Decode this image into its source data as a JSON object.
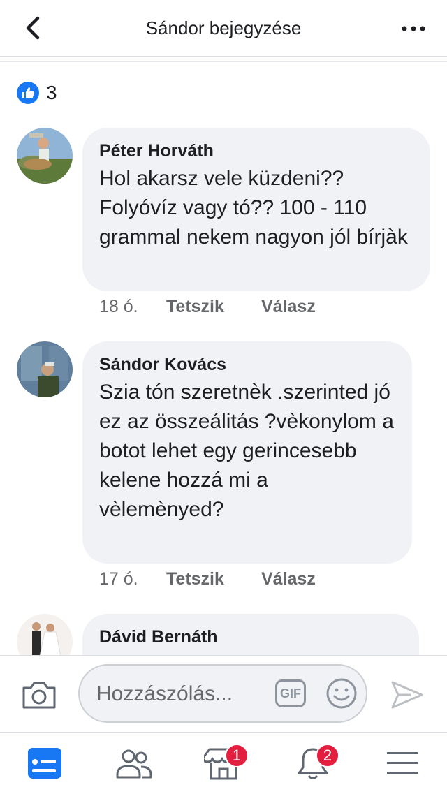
{
  "header": {
    "title": "Sándor bejegyzése"
  },
  "reactions": {
    "count": "3"
  },
  "comments": [
    {
      "author": "Péter Horváth",
      "text": "Hol akarsz vele küzdeni?? Folyóvíz vagy tó?? 100 - 110 grammal nekem nagyon jól bírjàk",
      "time": "18 ó.",
      "like_label": "Tetszik",
      "reply_label": "Válasz"
    },
    {
      "author": "Sándor Kovács",
      "text": "Szia tón szeretnèk .szerinted jó ez az összeálitás ?vèkonylom a botot lehet egy gerincesebb kelene hozzá mi a vèlemènyed?",
      "time": "17 ó.",
      "like_label": "Tetszik",
      "reply_label": "Válasz"
    },
    {
      "author": "Dávid Bernáth"
    }
  ],
  "composer": {
    "placeholder": "Hozzászólás...",
    "gif_label": "GIF"
  },
  "tabbar": {
    "marketplace_badge": "1",
    "notifications_badge": "2"
  },
  "colors": {
    "accent": "#1877f2",
    "badge": "#e41e3f",
    "bubble": "#f0f2f5"
  }
}
